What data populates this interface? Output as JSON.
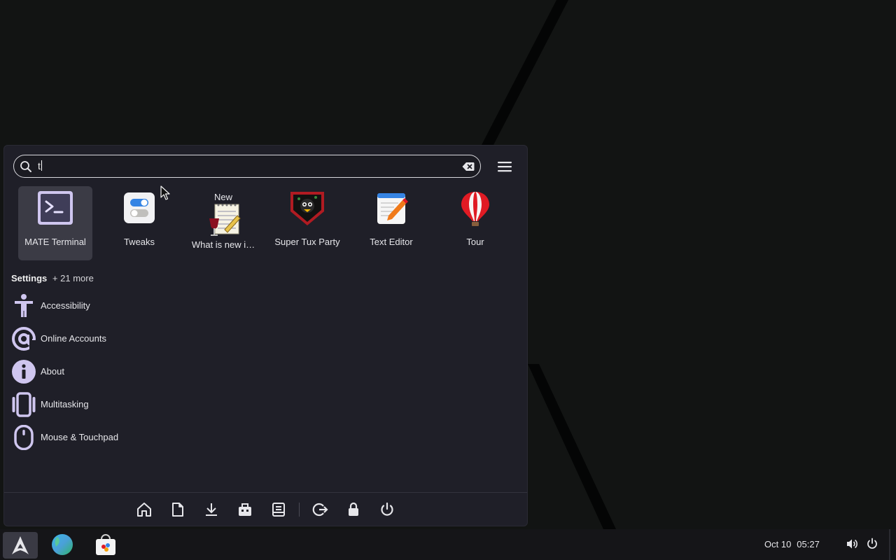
{
  "search": {
    "value": "t"
  },
  "apps": [
    {
      "label": "MATE Terminal",
      "icon": "terminal-icon",
      "selected": true
    },
    {
      "label": "Tweaks",
      "icon": "tweaks-icon"
    },
    {
      "label": "What is new i…",
      "badge": "New",
      "icon": "wine-notepad-icon"
    },
    {
      "label": "Super Tux Party",
      "icon": "supertux-party-icon"
    },
    {
      "label": "Text Editor",
      "icon": "text-editor-icon"
    },
    {
      "label": "Tour",
      "icon": "balloon-icon"
    }
  ],
  "settings": {
    "title": "Settings",
    "more": "+ 21 more",
    "items": [
      {
        "label": "Accessibility",
        "icon": "accessibility-icon"
      },
      {
        "label": "Online Accounts",
        "icon": "at-sign-icon"
      },
      {
        "label": "About",
        "icon": "info-icon"
      },
      {
        "label": "Multitasking",
        "icon": "multitasking-icon"
      },
      {
        "label": "Mouse & Touchpad",
        "icon": "mouse-icon"
      }
    ]
  },
  "bottom_bar": [
    "home-icon",
    "document-icon",
    "download-icon",
    "toolbox-icon",
    "archive-icon",
    "logout-icon",
    "lock-icon",
    "power-icon"
  ],
  "taskbar": {
    "date": "Oct 10",
    "time": "05:27",
    "apps": [
      "arch-launcher-icon",
      "browser-globe-icon",
      "software-store-icon"
    ],
    "tray": [
      "volume-icon",
      "power-icon"
    ]
  },
  "colors": {
    "panel": "#1f1f28",
    "selected": "#3b3b45",
    "accent_lilac": "#c9c0ea"
  }
}
